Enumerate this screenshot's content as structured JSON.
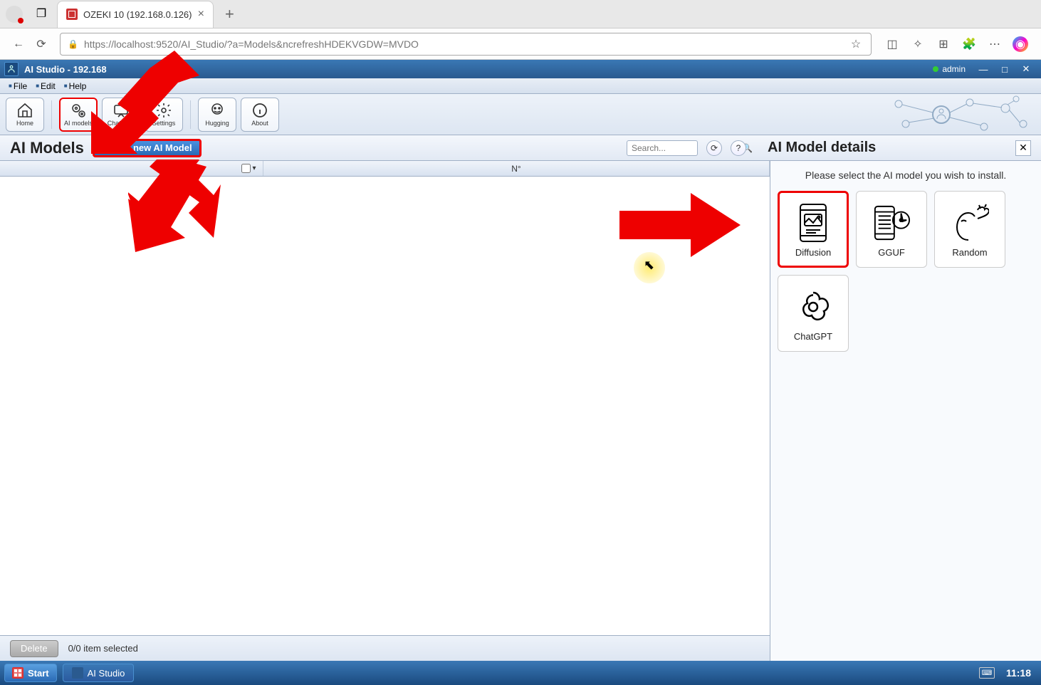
{
  "browser": {
    "tab_title": "OZEKI 10 (192.168.0.126)",
    "url": "https://localhost:9520/AI_Studio/?a=Models&ncrefreshHDEKVGDW=MVDO"
  },
  "app_title": "AI Studio - 192.168",
  "admin_label": "admin",
  "menu": {
    "file": "File",
    "edit": "Edit",
    "help": "Help"
  },
  "toolbar": {
    "home": "Home",
    "ai_models": "AI models",
    "chat_bots": "Chat bots",
    "settings": "Settings",
    "hugging": "Hugging",
    "about": "About"
  },
  "page_title": "AI Models",
  "create_btn": "Create new AI Model",
  "search_placeholder": "Search...",
  "table": {
    "num_header": "N°"
  },
  "footer": {
    "delete": "Delete",
    "selection": "0/0 item selected"
  },
  "details": {
    "title": "AI Model details",
    "instruction": "Please select the AI model you wish to install.",
    "models": {
      "diffusion": "Diffusion",
      "gguf": "GGUF",
      "random": "Random",
      "chatgpt": "ChatGPT"
    }
  },
  "taskbar": {
    "start": "Start",
    "ai_studio": "AI Studio",
    "time": "11:18"
  }
}
